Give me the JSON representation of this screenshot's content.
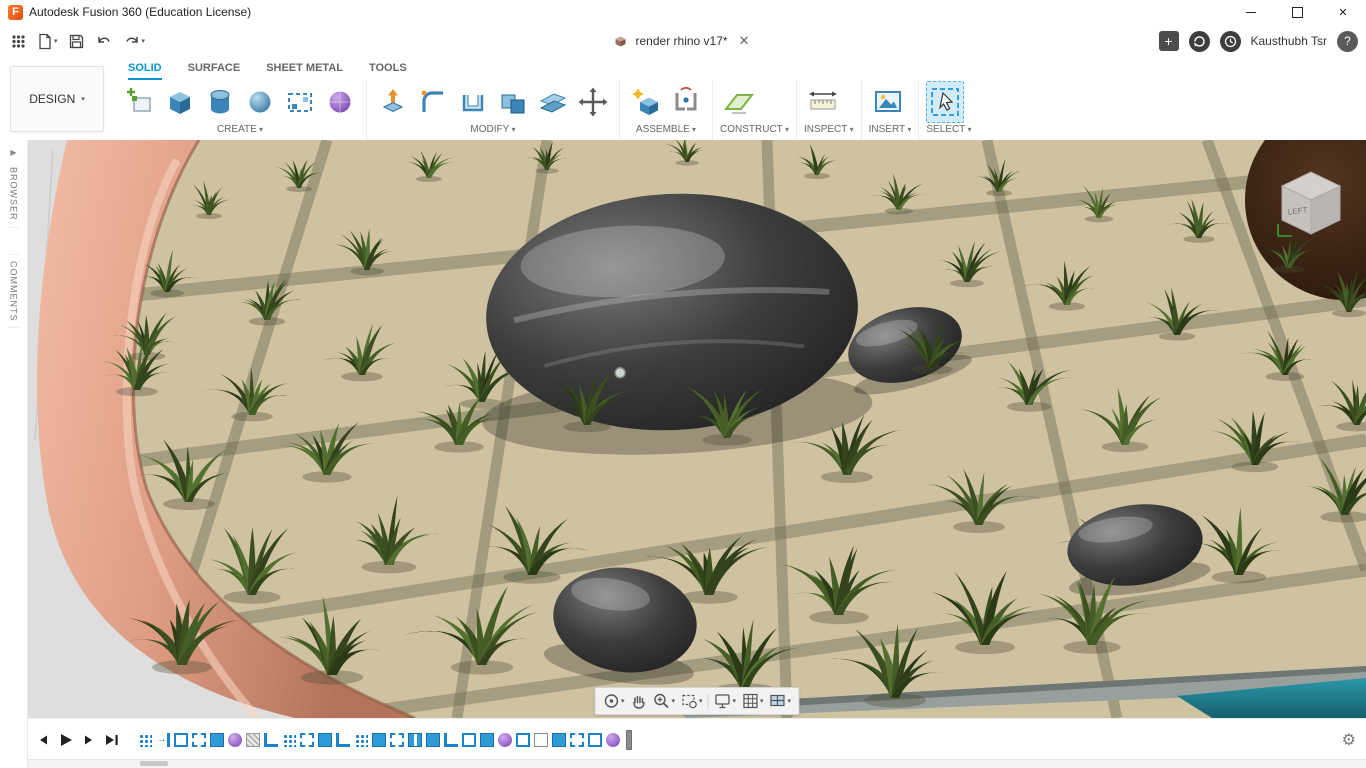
{
  "titlebar": {
    "title": "Autodesk Fusion 360 (Education License)"
  },
  "quickbar": {
    "doc_tab": "render rhino v17*",
    "user_name": "Kausthubh Tsr"
  },
  "ribbon": {
    "design_label": "DESIGN",
    "tabs": [
      {
        "label": "SOLID",
        "active": true
      },
      {
        "label": "SURFACE",
        "active": false
      },
      {
        "label": "SHEET METAL",
        "active": false
      },
      {
        "label": "TOOLS",
        "active": false
      }
    ],
    "groups": [
      {
        "label": "CREATE"
      },
      {
        "label": "MODIFY"
      },
      {
        "label": "ASSEMBLE"
      },
      {
        "label": "CONSTRUCT"
      },
      {
        "label": "INSPECT"
      },
      {
        "label": "INSERT"
      },
      {
        "label": "SELECT"
      }
    ]
  },
  "sidebar": {
    "tabs": [
      {
        "label": "BROWSER"
      },
      {
        "label": "COMMENTS"
      }
    ]
  },
  "viewport": {
    "viewcube_face": "LEFT"
  },
  "timeline": {
    "features": [
      "dots",
      "trim",
      "rect",
      "sketch",
      "solid",
      "form",
      "hatch",
      "corner",
      "dots",
      "sketch",
      "solid",
      "corner",
      "dots",
      "solid",
      "sketch",
      "joint",
      "solid",
      "corner",
      "rect",
      "solid",
      "form",
      "rect",
      "doc",
      "solid",
      "sketch",
      "rect",
      "form"
    ]
  },
  "colors": {
    "accent": "#0696d7",
    "copper": "#d49a82",
    "soil": "#cfc2a0",
    "grass": "#41551f",
    "water": "#2a8c9c"
  }
}
